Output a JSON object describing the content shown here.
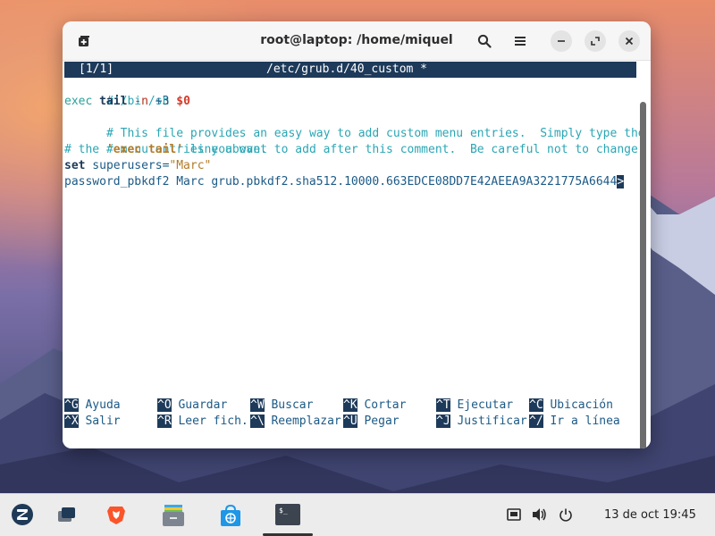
{
  "window": {
    "title": "root@laptop: /home/miquel"
  },
  "editor": {
    "header_left": "[1/1]",
    "header_center": "/etc/grub.d/40_custom *",
    "lines": {
      "l1": "#!/bin/sh",
      "l2_exec": "exec ",
      "l2_tail": "tail",
      "l2_sp": " ",
      "l2_n": "-n",
      "l2_num": " +3 ",
      "l2_var": "$0",
      "l3": "# This file provides an easy way to add custom menu entries.  Simply type the",
      "l4": "# menu entries you want to add after this comment.  Be careful not to change",
      "l5_a": "# the ",
      "l5_b": "'exec tail'",
      "l5_c": " line above.",
      "l6_set": "set",
      "l6_mid": " superusers=",
      "l6_val": "\"Marc\"",
      "l7": "password_pbkdf2 Marc grub.pbkdf2.sha512.10000.663EDCE08DD7E42AEEA9A3221775A6644",
      "l7_cursor": ">"
    },
    "shortcuts": [
      {
        "key": "^G",
        "label": " Ayuda"
      },
      {
        "key": "^O",
        "label": " Guardar"
      },
      {
        "key": "^W",
        "label": " Buscar"
      },
      {
        "key": "^K",
        "label": " Cortar"
      },
      {
        "key": "^T",
        "label": " Ejecutar"
      },
      {
        "key": "^C",
        "label": " Ubicación"
      },
      {
        "key": "^X",
        "label": " Salir"
      },
      {
        "key": "^R",
        "label": " Leer fich."
      },
      {
        "key": "^\\",
        "label": " Reemplazar"
      },
      {
        "key": "^U",
        "label": " Pegar"
      },
      {
        "key": "^J",
        "label": " Justificar"
      },
      {
        "key": "^/",
        "label": " Ir a línea"
      }
    ]
  },
  "taskbar": {
    "icons": [
      "zorin-menu-icon",
      "window-switcher-icon",
      "brave-browser-icon",
      "file-manager-icon",
      "software-store-icon",
      "terminal-icon"
    ],
    "clock": "13 de oct  19:45"
  },
  "colors": {
    "nano_bar": "#1d3a5a",
    "text": "#1c5a86",
    "comment": "#2aa6b4",
    "string": "#b27b2a",
    "variable": "#d33a2a"
  }
}
